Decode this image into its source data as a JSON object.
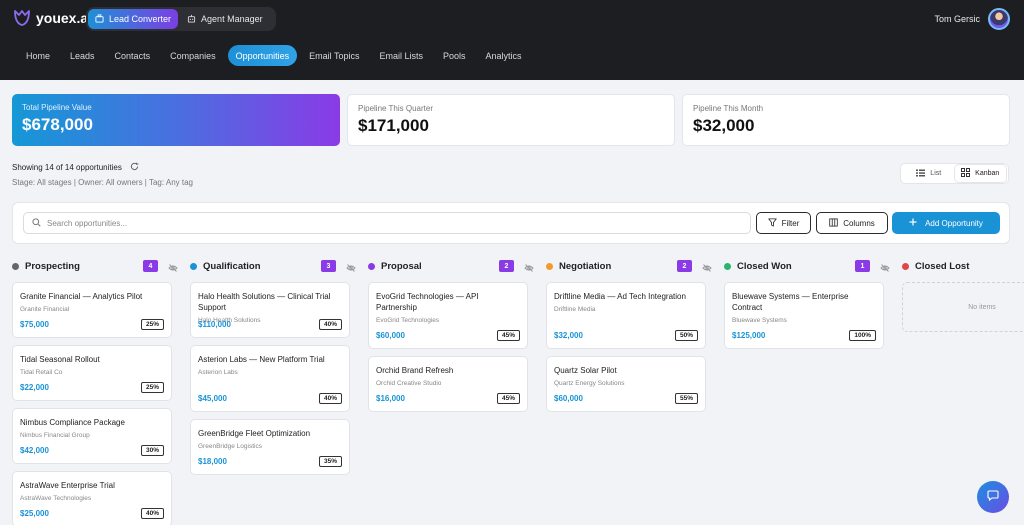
{
  "app": {
    "logo_text": "youex.ai",
    "switcher": [
      {
        "label": "Lead Converter",
        "icon": "briefcase-icon",
        "active": true
      },
      {
        "label": "Agent Manager",
        "icon": "robot-icon",
        "active": false
      }
    ],
    "user_name": "Tom Gersic"
  },
  "nav": [
    "Home",
    "Leads",
    "Contacts",
    "Companies",
    "Opportunities",
    "Email Topics",
    "Email Lists",
    "Pools",
    "Analytics"
  ],
  "nav_active": "Opportunities",
  "stats": [
    {
      "label": "Total Pipeline Value",
      "value": "$678,000"
    },
    {
      "label": "Pipeline This Quarter",
      "value": "$171,000"
    },
    {
      "label": "Pipeline This Month",
      "value": "$32,000"
    }
  ],
  "summary": {
    "showing": "Showing 14 of 14 opportunities",
    "filters": "Stage: All stages | Owner: All owners | Tag: Any tag"
  },
  "view_toggle": {
    "list": "List",
    "kanban": "Kanban",
    "active": "Kanban"
  },
  "toolbar": {
    "search_placeholder": "Search opportunities...",
    "filter": "Filter",
    "columns": "Columns",
    "add": "Add Opportunity"
  },
  "columns": [
    {
      "title": "Prospecting",
      "color": "#666666",
      "badge_color": "#8a3be6",
      "count": "4",
      "cards": [
        {
          "title": "Granite Financial — Analytics Pilot",
          "company": "Granite Financial",
          "value": "$75,000",
          "pct": "25%"
        },
        {
          "title": "Tidal Seasonal Rollout",
          "company": "Tidal Retail Co",
          "value": "$22,000",
          "pct": "25%"
        },
        {
          "title": "Nimbus Compliance Package",
          "company": "Nimbus Financial Group",
          "value": "$42,000",
          "pct": "30%"
        },
        {
          "title": "AstraWave Enterprise Trial",
          "company": "AstraWave Technologies",
          "value": "$25,000",
          "pct": "40%"
        }
      ]
    },
    {
      "title": "Qualification",
      "color": "#1a93d6",
      "badge_color": "#8a3be6",
      "count": "3",
      "cards": [
        {
          "title": "Halo Health Solutions — Clinical Trial Support",
          "company": "Halo Health Solutions",
          "value": "$110,000",
          "pct": "40%"
        },
        {
          "title": "Asterion Labs — New Platform Trial",
          "company": "Asterion Labs",
          "value": "$45,000",
          "pct": "40%"
        },
        {
          "title": "GreenBridge Fleet Optimization",
          "company": "GreenBridge Logistics",
          "value": "$18,000",
          "pct": "35%"
        }
      ]
    },
    {
      "title": "Proposal",
      "color": "#8a3be6",
      "badge_color": "#8a3be6",
      "count": "2",
      "cards": [
        {
          "title": "EvoGrid Technologies — API Partnership",
          "company": "EvoGrid Technologies",
          "value": "$60,000",
          "pct": "45%"
        },
        {
          "title": "Orchid Brand Refresh",
          "company": "Orchid Creative Studio",
          "value": "$16,000",
          "pct": "45%"
        }
      ]
    },
    {
      "title": "Negotiation",
      "color": "#f29b2a",
      "badge_color": "#8a3be6",
      "count": "2",
      "cards": [
        {
          "title": "Driftline Media — Ad Tech Integration",
          "company": "Driftline Media",
          "value": "$32,000",
          "pct": "50%"
        },
        {
          "title": "Quartz Solar Pilot",
          "company": "Quartz Energy Solutions",
          "value": "$60,000",
          "pct": "55%"
        }
      ]
    },
    {
      "title": "Closed Won",
      "color": "#2ab56b",
      "badge_color": "#8a3be6",
      "count": "1",
      "cards": [
        {
          "title": "Bluewave Systems — Enterprise Contract",
          "company": "Bluewave Systems",
          "value": "$125,000",
          "pct": "100%"
        }
      ]
    },
    {
      "title": "Closed Lost",
      "color": "#e04646",
      "empty_text": "No items",
      "cards": []
    }
  ]
}
